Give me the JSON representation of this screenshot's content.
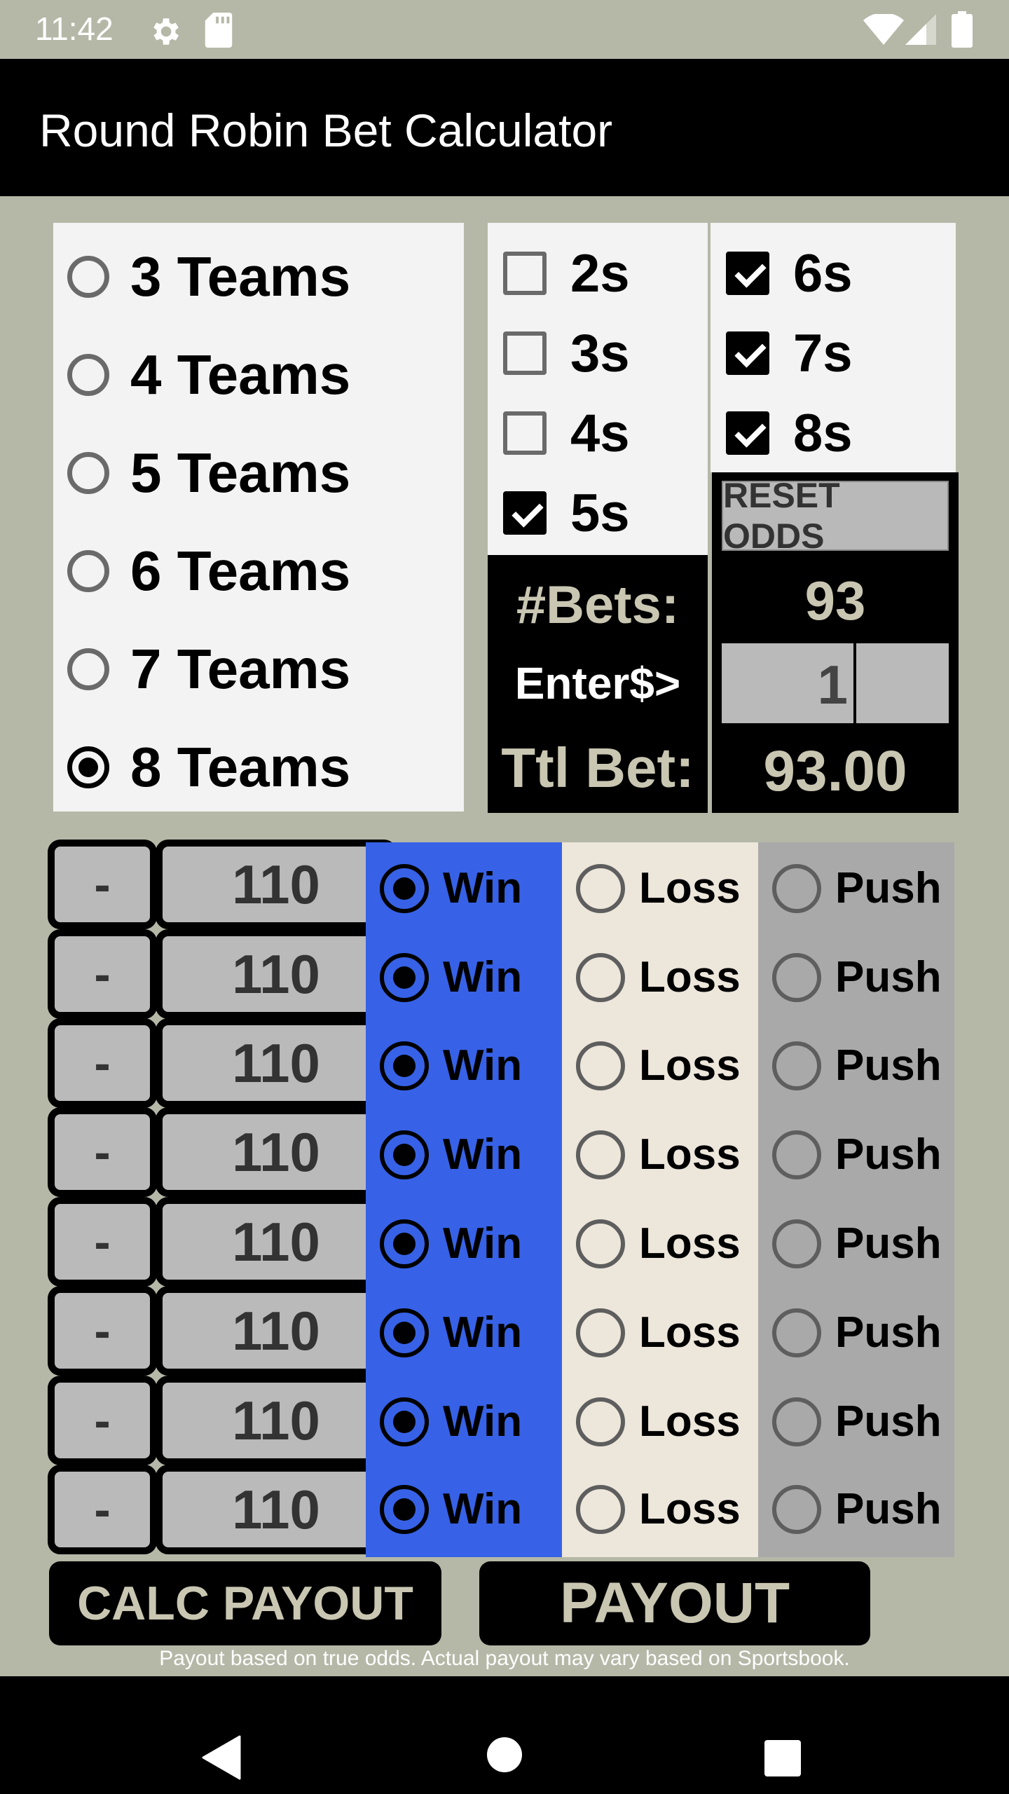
{
  "status_bar": {
    "time": "11:42",
    "icons": [
      "gear-icon",
      "sd-card-icon",
      "wifi-icon",
      "signal-icon",
      "battery-icon"
    ]
  },
  "app_bar": {
    "title": "Round Robin Bet Calculator"
  },
  "teams": {
    "options": [
      "3 Teams",
      "4 Teams",
      "5 Teams",
      "6 Teams",
      "7 Teams",
      "8 Teams"
    ],
    "selected": "8 Teams"
  },
  "parlay_sizes": {
    "left": [
      {
        "label": "2s",
        "checked": false
      },
      {
        "label": "3s",
        "checked": false
      },
      {
        "label": "4s",
        "checked": false
      },
      {
        "label": "5s",
        "checked": true
      }
    ],
    "right": [
      {
        "label": "6s",
        "checked": true
      },
      {
        "label": "7s",
        "checked": true
      },
      {
        "label": "8s",
        "checked": true
      }
    ]
  },
  "summary": {
    "reset_label": "RESET ODDS",
    "bets_label": "#Bets:",
    "bets_value": "93",
    "enter_label": "Enter$>",
    "stake_value": "1",
    "total_label": "Ttl Bet:",
    "total_value": "93.00"
  },
  "odds_rows": [
    {
      "sign": "-",
      "odds": "110",
      "result": "Win"
    },
    {
      "sign": "-",
      "odds": "110",
      "result": "Win"
    },
    {
      "sign": "-",
      "odds": "110",
      "result": "Win"
    },
    {
      "sign": "-",
      "odds": "110",
      "result": "Win"
    },
    {
      "sign": "-",
      "odds": "110",
      "result": "Win"
    },
    {
      "sign": "-",
      "odds": "110",
      "result": "Win"
    },
    {
      "sign": "-",
      "odds": "110",
      "result": "Win"
    },
    {
      "sign": "-",
      "odds": "110",
      "result": "Win"
    }
  ],
  "outcome_labels": {
    "win": "Win",
    "loss": "Loss",
    "push": "Push"
  },
  "buttons": {
    "calc_payout": "CALC PAYOUT",
    "payout": "PAYOUT"
  },
  "disclaimer": "Payout based on true odds. Actual payout may vary based on Sportsbook.",
  "colors": {
    "win_column": "#3762e7",
    "loss_column": "#ede6db",
    "push_column": "#a9a9a9",
    "accent_text": "#c9c6b2",
    "background": "#b5b8a7"
  }
}
